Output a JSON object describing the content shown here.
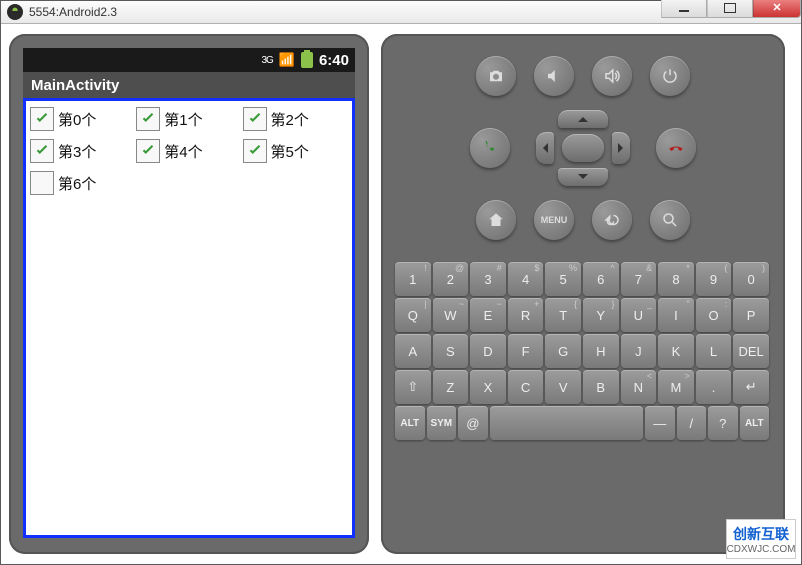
{
  "window": {
    "title": "5554:Android2.3"
  },
  "status": {
    "net": "3G",
    "clock": "6:40"
  },
  "app": {
    "title": "MainActivity"
  },
  "items": [
    {
      "label": "第0个",
      "checked": true
    },
    {
      "label": "第1个",
      "checked": true
    },
    {
      "label": "第2个",
      "checked": true
    },
    {
      "label": "第3个",
      "checked": true
    },
    {
      "label": "第4个",
      "checked": true
    },
    {
      "label": "第5个",
      "checked": true
    },
    {
      "label": "第6个",
      "checked": false
    }
  ],
  "hw_rows": {
    "top": [
      "camera",
      "vol-down",
      "vol-up",
      "power"
    ],
    "bottom": [
      "home",
      "menu",
      "back",
      "search"
    ]
  },
  "menu_label": "MENU",
  "keyboard": {
    "r1_sup": [
      "!",
      "@",
      "#",
      "$",
      "%",
      "^",
      "&",
      "*",
      "(",
      ")"
    ],
    "r1": [
      "1",
      "2",
      "3",
      "4",
      "5",
      "6",
      "7",
      "8",
      "9",
      "0"
    ],
    "r2_sup": [
      "|",
      "~",
      "−",
      "+",
      "{",
      "}",
      "_",
      "\"",
      ":",
      ""
    ],
    "r2": [
      "Q",
      "W",
      "E",
      "R",
      "T",
      "Y",
      "U",
      "I",
      "O",
      "P"
    ],
    "r3_sup": [
      "",
      "",
      "",
      "",
      "",
      "",
      "",
      "",
      "",
      ""
    ],
    "r3": [
      "A",
      "S",
      "D",
      "F",
      "G",
      "H",
      "J",
      "K",
      "L",
      "DEL"
    ],
    "r4_sup": [
      "",
      "",
      "",
      "",
      "",
      "",
      "<",
      ">",
      "",
      ""
    ],
    "r4": [
      "⇧",
      "Z",
      "X",
      "C",
      "V",
      "B",
      "N",
      "M",
      ".",
      "↵"
    ],
    "r5": [
      "ALT",
      "SYM",
      "@",
      " ",
      "—",
      "/",
      "?",
      "ALT"
    ]
  },
  "watermark": {
    "brand": "创新互联",
    "sub": "CDXWJC.COM"
  }
}
